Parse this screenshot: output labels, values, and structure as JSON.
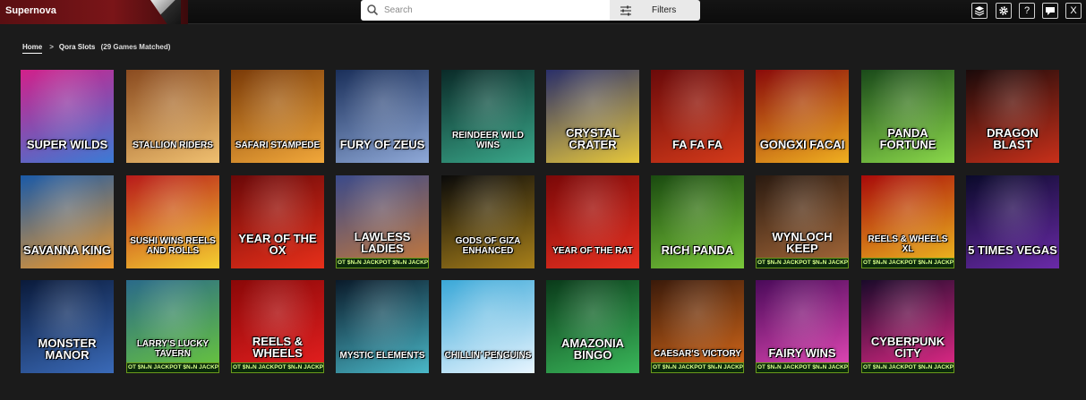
{
  "app": {
    "brand": "Supernova",
    "search_placeholder": "Search",
    "filters_label": "Filters",
    "toolbar": [
      {
        "name": "layers-button",
        "icon": "layers-icon"
      },
      {
        "name": "settings-button",
        "icon": "gear-icon"
      },
      {
        "name": "help-button",
        "label": "?"
      },
      {
        "name": "chat-button",
        "icon": "chat-icon"
      },
      {
        "name": "close-button",
        "label": "X"
      }
    ]
  },
  "breadcrumb": {
    "home": "Home",
    "separator": ">",
    "current": "Qora Slots",
    "count": "(29 Games Matched)"
  },
  "jackpot_text": "OT $N₂N JACKPOT $N₂N JACKPOT $N₂N JACK",
  "games": [
    {
      "title": "Super Wilds",
      "bg": [
        "#d2208a",
        "#3a7bd5"
      ],
      "jackpot": false
    },
    {
      "title": "Stallion Riders",
      "bg": [
        "#8a4b20",
        "#f0c070"
      ],
      "jackpot": false
    },
    {
      "title": "Safari Stampede",
      "bg": [
        "#7a3a08",
        "#f2a83a"
      ],
      "jackpot": false
    },
    {
      "title": "Fury of Zeus",
      "bg": [
        "#1a2f5a",
        "#8fa9d8"
      ],
      "jackpot": false
    },
    {
      "title": "Reindeer Wild Wins",
      "bg": [
        "#0a2a28",
        "#3aa88a"
      ],
      "jackpot": false
    },
    {
      "title": "Crystal Crater",
      "bg": [
        "#2a2f6a",
        "#e8c83a"
      ],
      "jackpot": false
    },
    {
      "title": "Fa Fa Fa",
      "bg": [
        "#6a0a0a",
        "#d43a1a"
      ],
      "jackpot": false
    },
    {
      "title": "Gongxi Facai",
      "bg": [
        "#8a0a0a",
        "#f0b020"
      ],
      "jackpot": false
    },
    {
      "title": "Panda Fortune",
      "bg": [
        "#1a4a1a",
        "#8ad84a"
      ],
      "jackpot": false
    },
    {
      "title": "Dragon Blast",
      "bg": [
        "#1a0a0a",
        "#c8301a"
      ],
      "jackpot": false
    },
    {
      "title": "Savanna King",
      "bg": [
        "#1a5aa8",
        "#f09a2a"
      ],
      "jackpot": false
    },
    {
      "title": "Sushi Wins Reels and Rolls",
      "bg": [
        "#b81a1a",
        "#f5d030"
      ],
      "jackpot": false
    },
    {
      "title": "Year of the Ox",
      "bg": [
        "#6a0808",
        "#e8301a"
      ],
      "jackpot": false
    },
    {
      "title": "Lawless Ladies",
      "bg": [
        "#3a4a8a",
        "#c87a3a"
      ],
      "jackpot": true
    },
    {
      "title": "Gods of Giza Enhanced",
      "bg": [
        "#0a0a0a",
        "#a8801a"
      ],
      "jackpot": false
    },
    {
      "title": "Year of the Rat",
      "bg": [
        "#7a0808",
        "#e83020"
      ],
      "jackpot": false
    },
    {
      "title": "Rich Panda",
      "bg": [
        "#1a4a10",
        "#7ac83a"
      ],
      "jackpot": false
    },
    {
      "title": "Wynloch Keep",
      "bg": [
        "#2a1a10",
        "#a86a3a"
      ],
      "jackpot": true
    },
    {
      "title": "Reels & Wheels XL",
      "bg": [
        "#a80a0a",
        "#f0c020"
      ],
      "jackpot": true
    },
    {
      "title": "5 Times Vegas",
      "bg": [
        "#0a0a2a",
        "#6a2aa8"
      ],
      "jackpot": false
    },
    {
      "title": "Monster Manor",
      "bg": [
        "#0a1a3a",
        "#3a6ab8"
      ],
      "jackpot": false
    },
    {
      "title": "Larry's Lucky Tavern",
      "bg": [
        "#2a6a8a",
        "#6ac83a"
      ],
      "jackpot": true
    },
    {
      "title": "Reels & Wheels",
      "bg": [
        "#8a0808",
        "#e82020"
      ],
      "jackpot": true
    },
    {
      "title": "Mystic Elements",
      "bg": [
        "#0a1a2a",
        "#4ab8c8"
      ],
      "jackpot": false
    },
    {
      "title": "Chillin' Penguins",
      "bg": [
        "#3aa8d8",
        "#e8f5ff"
      ],
      "jackpot": false
    },
    {
      "title": "Amazonia Bingo",
      "bg": [
        "#0a3a1a",
        "#3ab85a"
      ],
      "jackpot": false
    },
    {
      "title": "Caesar's Victory",
      "bg": [
        "#3a1a0a",
        "#d86a1a"
      ],
      "jackpot": true
    },
    {
      "title": "Fairy Wins",
      "bg": [
        "#4a0a5a",
        "#e84ab8"
      ],
      "jackpot": true
    },
    {
      "title": "Cyberpunk City",
      "bg": [
        "#1a0a2a",
        "#e82a8a"
      ],
      "jackpot": true
    }
  ]
}
